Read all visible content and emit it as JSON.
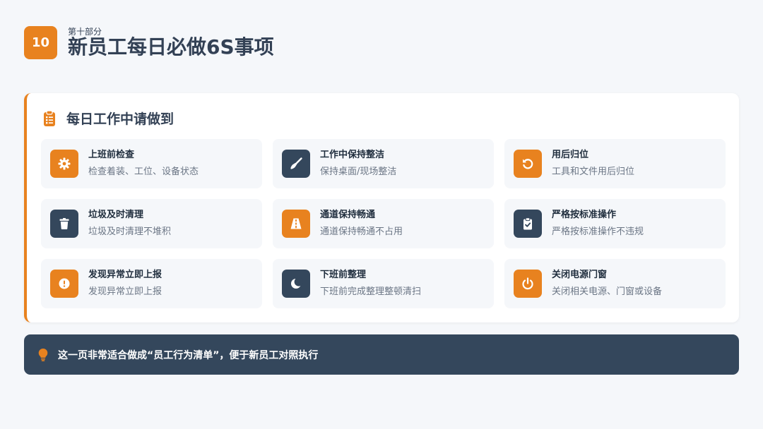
{
  "header": {
    "number": "10",
    "section_label": "第十部分",
    "title": "新员工每日必做6S事项"
  },
  "card": {
    "icon": "clipboard-list-icon",
    "title": "每日工作中请做到",
    "items": [
      {
        "title": "上班前检查",
        "desc": "检查着装、工位、设备状态",
        "icon": "gear-icon",
        "color": "#e8821f"
      },
      {
        "title": "工作中保持整洁",
        "desc": "保持桌面/现场整洁",
        "icon": "broom-icon",
        "color": "#34475c"
      },
      {
        "title": "用后归位",
        "desc": "工具和文件用后归位",
        "icon": "undo-icon",
        "color": "#e8821f"
      },
      {
        "title": "垃圾及时清理",
        "desc": "垃圾及时清理不堆积",
        "icon": "trash-icon",
        "color": "#34475c"
      },
      {
        "title": "通道保持畅通",
        "desc": "通道保持畅通不占用",
        "icon": "road-icon",
        "color": "#e8821f"
      },
      {
        "title": "严格按标准操作",
        "desc": "严格按标准操作不违规",
        "icon": "clipboard-check-icon",
        "color": "#34475c"
      },
      {
        "title": "发现异常立即上报",
        "desc": "发现异常立即上报",
        "icon": "exclamation-circle-icon",
        "color": "#e8821f"
      },
      {
        "title": "下班前整理",
        "desc": "下班前完成整理整顿清扫",
        "icon": "moon-icon",
        "color": "#34475c"
      },
      {
        "title": "关闭电源门窗",
        "desc": "关闭相关电源、门窗或设备",
        "icon": "power-icon",
        "color": "#e8821f"
      }
    ]
  },
  "tip": {
    "icon": "lightbulb-icon",
    "text": "这一页非常适合做成“员工行为清单”，便于新员工对照执行"
  },
  "colors": {
    "accent": "#e8821f",
    "dark": "#34475c",
    "background": "#f5f7fa"
  }
}
